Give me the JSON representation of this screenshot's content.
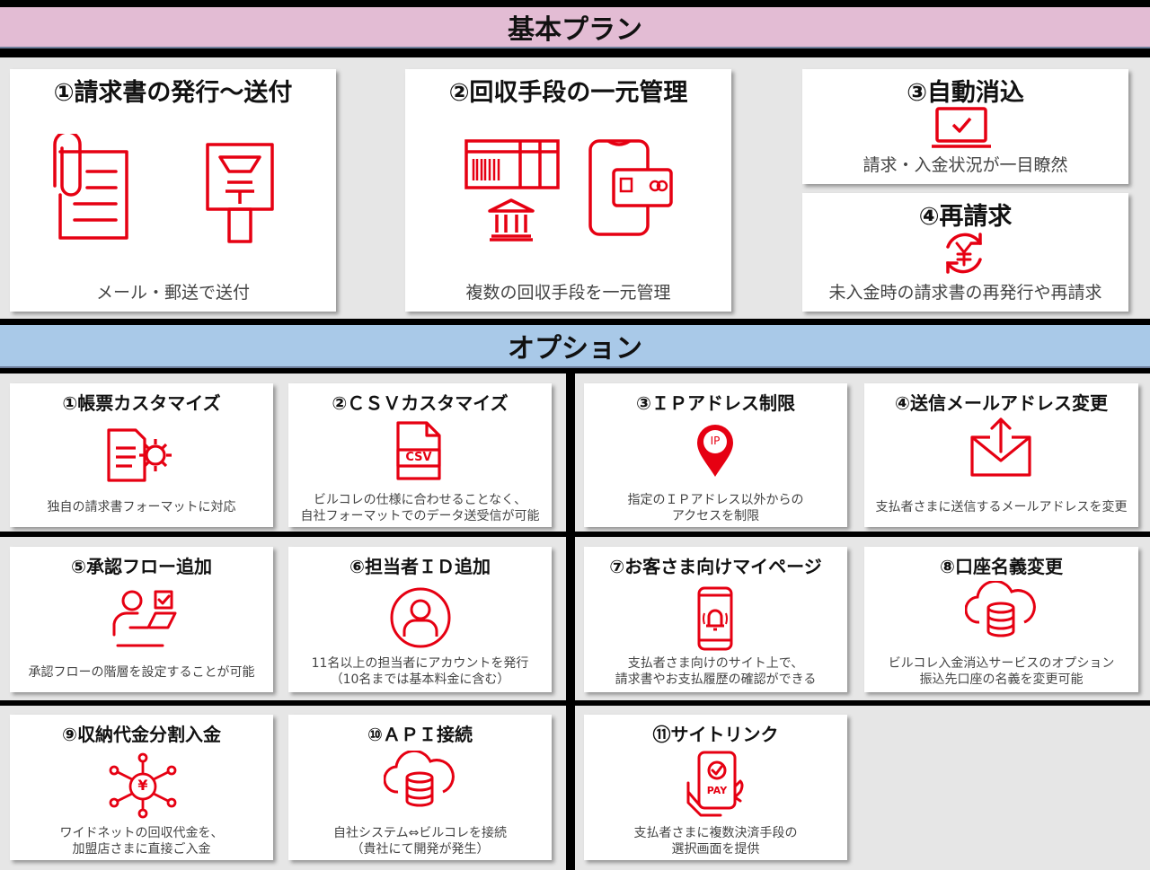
{
  "header": {
    "basic_plan": "基本プラン",
    "options": "オプション"
  },
  "accent_color": "#e60012",
  "basic": [
    {
      "title": "①請求書の発行～送付",
      "desc": "メール・郵送で送付",
      "icons": [
        "paperclip-document-icon",
        "postbox-icon"
      ]
    },
    {
      "title": "②回収手段の一元管理",
      "desc": "複数の回収手段を一元管理",
      "icons": [
        "payment-slip-icon",
        "bank-icon",
        "smartphone-card-icon"
      ]
    },
    {
      "title": "③自動消込",
      "desc": "請求・入金状況が一目瞭然",
      "icons": [
        "laptop-check-icon"
      ]
    },
    {
      "title": "④再請求",
      "desc": "未入金時の請求書の再発行や再請求",
      "icons": [
        "yen-cycle-icon"
      ]
    }
  ],
  "options": [
    {
      "title": "①帳票カスタマイズ",
      "desc": "独自の請求書フォーマットに対応",
      "icon": "document-gear-icon"
    },
    {
      "title": "②ＣＳＶカスタマイズ",
      "desc": "ビルコレの仕様に合わせることなく、\n自社フォーマットでのデータ送受信が可能",
      "icon": "csv-file-icon",
      "icon_label": "CSV"
    },
    {
      "title": "③ＩＰアドレス制限",
      "desc": "指定のＩＰアドレス以外からの\nアクセスを制限",
      "icon": "ip-pin-icon",
      "icon_label": "IP"
    },
    {
      "title": "④送信メールアドレス変更",
      "desc": "支払者さまに送信するメールアドレスを変更",
      "icon": "mail-send-icon"
    },
    {
      "title": "⑤承認フロー追加",
      "desc": "承認フローの階層を設定することが可能",
      "icon": "user-approval-icon"
    },
    {
      "title": "⑥担当者ＩＤ追加",
      "desc": "11名以上の担当者にアカウントを発行\n（10名までは基本料金に含む）",
      "icon": "user-circle-icon"
    },
    {
      "title": "⑦お客さま向けマイページ",
      "desc": "支払者さま向けのサイト上で、\n請求書やお支払履歴の確認ができる",
      "icon": "phone-bell-icon"
    },
    {
      "title": "⑧口座名義変更",
      "desc": "ビルコレ入金消込サービスのオプション\n振込先口座の名義を変更可能",
      "icon": "cloud-database-icon"
    },
    {
      "title": "⑨収納代金分割入金",
      "desc": "ワイドネットの回収代金を、\n加盟店さまに直接ご入金",
      "icon": "yen-network-icon",
      "icon_label": "¥"
    },
    {
      "title": "⑩ＡＰＩ接続",
      "desc": "自社システム⇔ビルコレを接続\n（貴社にて開発が発生）",
      "icon": "cloud-database-icon"
    },
    {
      "title": "⑪サイトリンク",
      "desc": "支払者さまに複数決済手段の\n選択画面を提供",
      "icon": "hand-phone-pay-icon",
      "icon_label": "PAY"
    }
  ]
}
